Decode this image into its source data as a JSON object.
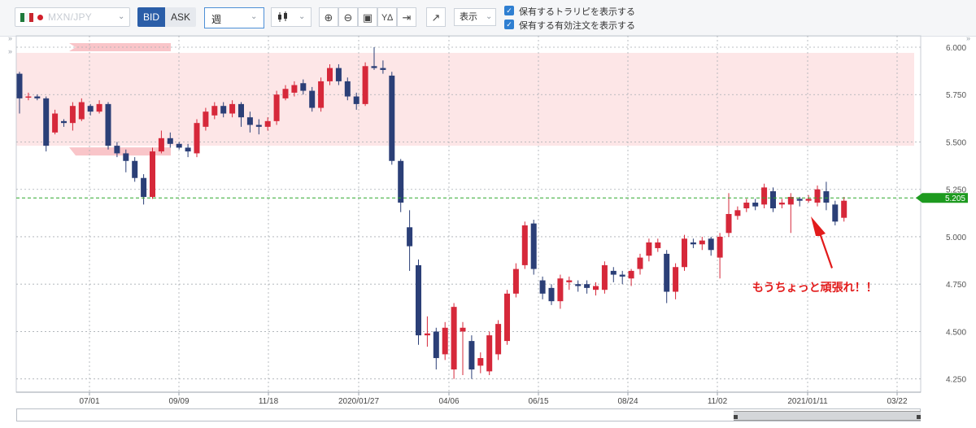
{
  "toolbar": {
    "pair": "MXN/JPY",
    "bid_label": "BID",
    "ask_label": "ASK",
    "period": "週",
    "display_label": "表示",
    "option_show_trailing": "保有するトラリピを表示する",
    "option_show_orders": "保有する有効注文を表示する",
    "icons": [
      "chart-type-candle-icon",
      "zoom-in-icon",
      "zoom-out-icon",
      "fit-icon",
      "range-icon",
      "scroll-end-icon",
      "indicator-icon"
    ]
  },
  "colors": {
    "up": "#d6283a",
    "down": "#2b3f77",
    "range_band": "#fde6e7",
    "current_line": "#2ea82b",
    "annotation": "#e21b1b"
  },
  "chart_data": {
    "type": "candlestick",
    "ylim": [
      4.18,
      6.06
    ],
    "y_ticks": [
      "6.000",
      "5.750",
      "5.500",
      "5.250",
      "5.000",
      "4.750",
      "4.500",
      "4.250"
    ],
    "x_ticks": [
      "07/01",
      "09/09",
      "11/18",
      "2020/01/27",
      "04/06",
      "06/15",
      "08/24",
      "11/02",
      "2021/01/11",
      "03/22"
    ],
    "current_price": "5.205",
    "range_band": [
      5.48,
      5.97
    ],
    "annotation": "もうちょっと頑張れ！！",
    "candles": [
      [
        5.86,
        5.73,
        5.87,
        5.65
      ],
      [
        5.74,
        5.74,
        5.76,
        5.72
      ],
      [
        5.74,
        5.73,
        5.75,
        5.72
      ],
      [
        5.73,
        5.48,
        5.74,
        5.45
      ],
      [
        5.55,
        5.65,
        5.67,
        5.54
      ],
      [
        5.61,
        5.6,
        5.62,
        5.58
      ],
      [
        5.6,
        5.69,
        5.71,
        5.56
      ],
      [
        5.62,
        5.71,
        5.73,
        5.61
      ],
      [
        5.69,
        5.66,
        5.7,
        5.64
      ],
      [
        5.66,
        5.7,
        5.72,
        5.65
      ],
      [
        5.7,
        5.48,
        5.71,
        5.46
      ],
      [
        5.48,
        5.44,
        5.5,
        5.42
      ],
      [
        5.44,
        5.4,
        5.46,
        5.34
      ],
      [
        5.4,
        5.31,
        5.42,
        5.29
      ],
      [
        5.31,
        5.21,
        5.33,
        5.17
      ],
      [
        5.21,
        5.45,
        5.47,
        5.2
      ],
      [
        5.45,
        5.52,
        5.56,
        5.44
      ],
      [
        5.52,
        5.49,
        5.55,
        5.47
      ],
      [
        5.49,
        5.47,
        5.5,
        5.46
      ],
      [
        5.47,
        5.45,
        5.49,
        5.42
      ],
      [
        5.44,
        5.6,
        5.62,
        5.42
      ],
      [
        5.58,
        5.66,
        5.68,
        5.56
      ],
      [
        5.64,
        5.69,
        5.71,
        5.62
      ],
      [
        5.69,
        5.65,
        5.71,
        5.63
      ],
      [
        5.65,
        5.7,
        5.72,
        5.63
      ],
      [
        5.7,
        5.63,
        5.71,
        5.58
      ],
      [
        5.63,
        5.59,
        5.66,
        5.55
      ],
      [
        5.59,
        5.58,
        5.62,
        5.54
      ],
      [
        5.58,
        5.61,
        5.63,
        5.56
      ],
      [
        5.61,
        5.75,
        5.77,
        5.59
      ],
      [
        5.73,
        5.78,
        5.8,
        5.72
      ],
      [
        5.76,
        5.8,
        5.82,
        5.74
      ],
      [
        5.81,
        5.77,
        5.83,
        5.75
      ],
      [
        5.77,
        5.68,
        5.79,
        5.66
      ],
      [
        5.68,
        5.82,
        5.84,
        5.66
      ],
      [
        5.82,
        5.89,
        5.91,
        5.8
      ],
      [
        5.89,
        5.82,
        5.91,
        5.8
      ],
      [
        5.82,
        5.74,
        5.84,
        5.72
      ],
      [
        5.74,
        5.7,
        5.76,
        5.67
      ],
      [
        5.7,
        5.9,
        5.92,
        5.69
      ],
      [
        5.9,
        5.89,
        6.0,
        5.88
      ],
      [
        5.89,
        5.88,
        5.93,
        5.86
      ],
      [
        5.85,
        5.4,
        5.87,
        5.38
      ],
      [
        5.4,
        5.18,
        5.41,
        5.13
      ],
      [
        5.05,
        4.95,
        5.14,
        4.82
      ],
      [
        4.85,
        4.48,
        4.88,
        4.43
      ],
      [
        4.48,
        4.49,
        4.58,
        4.42
      ],
      [
        4.5,
        4.36,
        4.52,
        4.3
      ],
      [
        4.38,
        4.52,
        4.55,
        4.35
      ],
      [
        4.3,
        4.63,
        4.65,
        4.25
      ],
      [
        4.5,
        4.52,
        4.55,
        4.27
      ],
      [
        4.45,
        4.3,
        4.48,
        4.25
      ],
      [
        4.32,
        4.36,
        4.39,
        4.28
      ],
      [
        4.29,
        4.48,
        4.5,
        4.27
      ],
      [
        4.38,
        4.54,
        4.56,
        4.35
      ],
      [
        4.45,
        4.7,
        4.72,
        4.43
      ],
      [
        4.7,
        4.83,
        4.86,
        4.68
      ],
      [
        4.85,
        5.06,
        5.08,
        4.83
      ],
      [
        5.07,
        4.83,
        5.09,
        4.8
      ],
      [
        4.77,
        4.7,
        4.79,
        4.67
      ],
      [
        4.73,
        4.66,
        4.75,
        4.64
      ],
      [
        4.66,
        4.78,
        4.8,
        4.62
      ],
      [
        4.76,
        4.77,
        4.79,
        4.72
      ],
      [
        4.75,
        4.74,
        4.77,
        4.71
      ],
      [
        4.75,
        4.73,
        4.77,
        4.7
      ],
      [
        4.72,
        4.74,
        4.76,
        4.69
      ],
      [
        4.72,
        4.85,
        4.87,
        4.7
      ],
      [
        4.82,
        4.8,
        4.84,
        4.76
      ],
      [
        4.8,
        4.79,
        4.82,
        4.75
      ],
      [
        4.78,
        4.82,
        4.83,
        4.74
      ],
      [
        4.83,
        4.89,
        4.91,
        4.8
      ],
      [
        4.9,
        4.97,
        4.99,
        4.87
      ],
      [
        4.94,
        4.97,
        4.99,
        4.92
      ],
      [
        4.91,
        4.71,
        4.93,
        4.65
      ],
      [
        4.71,
        4.84,
        4.86,
        4.67
      ],
      [
        4.84,
        4.99,
        5.01,
        4.82
      ],
      [
        4.97,
        4.96,
        4.99,
        4.94
      ],
      [
        4.96,
        4.98,
        5.0,
        4.93
      ],
      [
        4.99,
        4.93,
        5.0,
        4.9
      ],
      [
        4.89,
        5.0,
        5.02,
        4.78
      ],
      [
        5.02,
        5.12,
        5.23,
        5.0
      ],
      [
        5.11,
        5.14,
        5.16,
        5.09
      ],
      [
        5.15,
        5.18,
        5.2,
        5.13
      ],
      [
        5.18,
        5.16,
        5.2,
        5.14
      ],
      [
        5.17,
        5.26,
        5.28,
        5.15
      ],
      [
        5.24,
        5.15,
        5.26,
        5.13
      ],
      [
        5.17,
        5.18,
        5.2,
        5.15
      ],
      [
        5.17,
        5.21,
        5.23,
        5.02
      ],
      [
        5.2,
        5.19,
        5.21,
        5.16
      ],
      [
        5.19,
        5.2,
        5.22,
        5.18
      ],
      [
        5.18,
        5.25,
        5.27,
        5.16
      ],
      [
        5.24,
        5.18,
        5.29,
        5.14
      ],
      [
        5.17,
        5.08,
        5.19,
        5.06
      ],
      [
        5.1,
        5.19,
        5.21,
        5.08
      ]
    ]
  }
}
